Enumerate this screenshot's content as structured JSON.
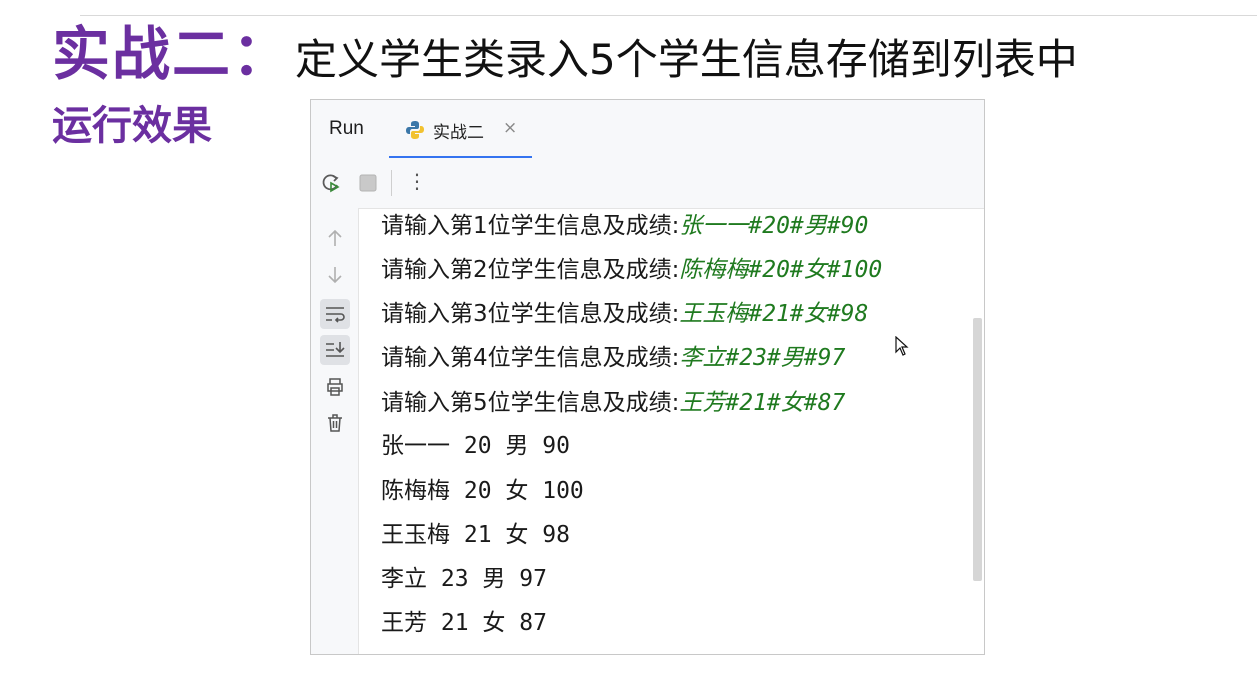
{
  "slide": {
    "title_main": "实战二：",
    "title_sub": "定义学生类录入5个学生信息存储到列表中",
    "section_label": "运行效果"
  },
  "run_window": {
    "run_label": "Run",
    "tab": {
      "label": "实战二",
      "close": "×",
      "icon": "python-icon"
    },
    "toolbar": [
      "rerun-icon",
      "stop-icon",
      "more-icon"
    ],
    "more_glyph": "⋮",
    "gutter_icons": [
      "arrow-up-icon",
      "arrow-down-icon",
      "soft-wrap-icon",
      "scroll-to-end-icon",
      "print-icon",
      "trash-icon"
    ],
    "console": {
      "prompts": [
        {
          "prompt": "请输入第1位学生信息及成绩:",
          "input": "张一一#20#男#90"
        },
        {
          "prompt": "请输入第2位学生信息及成绩:",
          "input": "陈梅梅#20#女#100"
        },
        {
          "prompt": "请输入第3位学生信息及成绩:",
          "input": "王玉梅#21#女#98"
        },
        {
          "prompt": "请输入第4位学生信息及成绩:",
          "input": "李立#23#男#97"
        },
        {
          "prompt": "请输入第5位学生信息及成绩:",
          "input": "王芳#21#女#87"
        }
      ],
      "outputs": [
        "张一一 20 男 90",
        "陈梅梅 20 女 100",
        "王玉梅 21 女 98",
        "李立 23 男 97",
        "王芳 21 女 87"
      ]
    }
  }
}
